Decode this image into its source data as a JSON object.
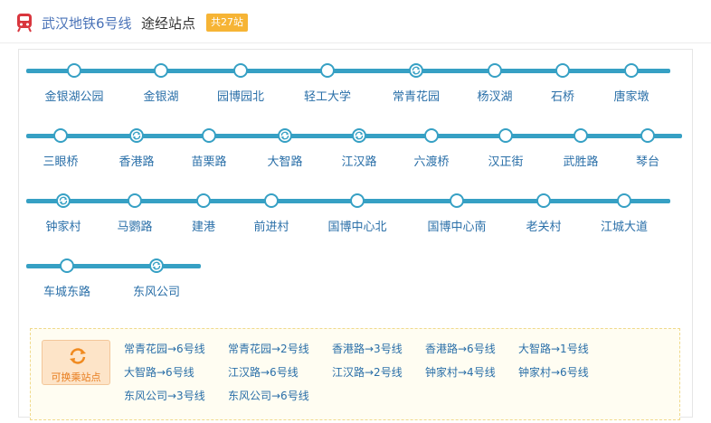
{
  "header": {
    "line_title": "武汉地铁6号线",
    "subtitle": "途经站点",
    "badge": "共27站"
  },
  "rows": [
    [
      {
        "name": "金银湖公园",
        "transfer": false
      },
      {
        "name": "金银湖",
        "transfer": false
      },
      {
        "name": "园博园北",
        "transfer": false
      },
      {
        "name": "轻工大学",
        "transfer": false
      },
      {
        "name": "常青花园",
        "transfer": true
      },
      {
        "name": "杨汊湖",
        "transfer": false
      },
      {
        "name": "石桥",
        "transfer": false
      },
      {
        "name": "唐家墩",
        "transfer": false
      }
    ],
    [
      {
        "name": "三眼桥",
        "transfer": false
      },
      {
        "name": "香港路",
        "transfer": true
      },
      {
        "name": "苗栗路",
        "transfer": false
      },
      {
        "name": "大智路",
        "transfer": true
      },
      {
        "name": "江汉路",
        "transfer": true
      },
      {
        "name": "六渡桥",
        "transfer": false
      },
      {
        "name": "汉正街",
        "transfer": false
      },
      {
        "name": "武胜路",
        "transfer": false
      },
      {
        "name": "琴台",
        "transfer": false
      }
    ],
    [
      {
        "name": "钟家村",
        "transfer": true
      },
      {
        "name": "马鹦路",
        "transfer": false
      },
      {
        "name": "建港",
        "transfer": false
      },
      {
        "name": "前进村",
        "transfer": false
      },
      {
        "name": "国博中心北",
        "transfer": false
      },
      {
        "name": "国博中心南",
        "transfer": false
      },
      {
        "name": "老关村",
        "transfer": false
      },
      {
        "name": "江城大道",
        "transfer": false
      }
    ],
    [
      {
        "name": "车城东路",
        "transfer": false
      },
      {
        "name": "东风公司",
        "transfer": true
      }
    ]
  ],
  "transfer_panel": {
    "button_label": "可换乘站点",
    "items": [
      "常青花园→6号线",
      "常青花园→2号线",
      "香港路→3号线",
      "香港路→6号线",
      "大智路→1号线",
      "大智路→6号线",
      "江汉路→6号线",
      "江汉路→2号线",
      "钟家村→4号线",
      "钟家村→6号线",
      "东风公司→3号线",
      "东风公司→6号线"
    ]
  },
  "colors": {
    "track": "#36a0c4",
    "station_text": "#2a6fa8",
    "badge": "#f6b435",
    "transfer_accent": "#e87d1e"
  }
}
